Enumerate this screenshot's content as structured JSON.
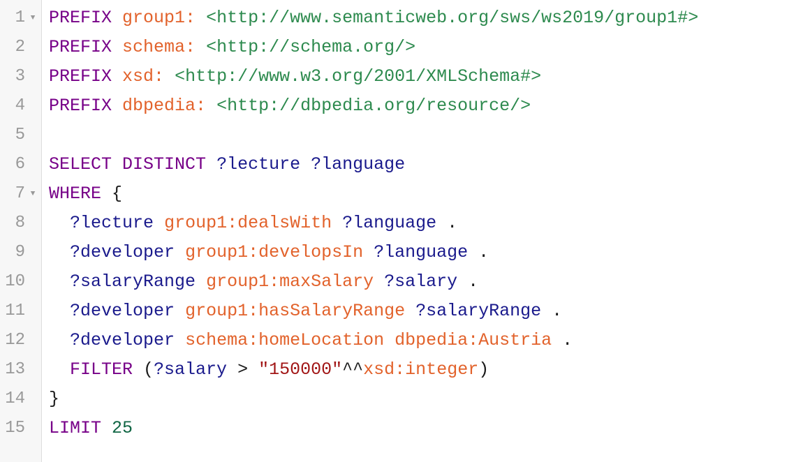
{
  "editor": {
    "fold_marker": "▼",
    "lines": [
      {
        "n": "1",
        "foldable": true,
        "tokens": [
          {
            "t": "PREFIX",
            "k": "kw"
          },
          {
            "t": " ",
            "k": "pn"
          },
          {
            "t": "group1:",
            "k": "pfx"
          },
          {
            "t": " ",
            "k": "pn"
          },
          {
            "t": "<http://www.semanticweb.org/sws/ws2019/group1#>",
            "k": "iri"
          }
        ]
      },
      {
        "n": "2",
        "foldable": false,
        "tokens": [
          {
            "t": "PREFIX",
            "k": "kw"
          },
          {
            "t": " ",
            "k": "pn"
          },
          {
            "t": "schema:",
            "k": "pfx"
          },
          {
            "t": " ",
            "k": "pn"
          },
          {
            "t": "<http://schema.org/>",
            "k": "iri"
          }
        ]
      },
      {
        "n": "3",
        "foldable": false,
        "tokens": [
          {
            "t": "PREFIX",
            "k": "kw"
          },
          {
            "t": " ",
            "k": "pn"
          },
          {
            "t": "xsd:",
            "k": "pfx"
          },
          {
            "t": " ",
            "k": "pn"
          },
          {
            "t": "<http://www.w3.org/2001/XMLSchema#>",
            "k": "iri"
          }
        ]
      },
      {
        "n": "4",
        "foldable": false,
        "tokens": [
          {
            "t": "PREFIX",
            "k": "kw"
          },
          {
            "t": " ",
            "k": "pn"
          },
          {
            "t": "dbpedia:",
            "k": "pfx"
          },
          {
            "t": " ",
            "k": "pn"
          },
          {
            "t": "<http://dbpedia.org/resource/>",
            "k": "iri"
          }
        ]
      },
      {
        "n": "5",
        "foldable": false,
        "tokens": []
      },
      {
        "n": "6",
        "foldable": false,
        "tokens": [
          {
            "t": "SELECT",
            "k": "kw"
          },
          {
            "t": " ",
            "k": "pn"
          },
          {
            "t": "DISTINCT",
            "k": "kw"
          },
          {
            "t": " ",
            "k": "pn"
          },
          {
            "t": "?lecture",
            "k": "var"
          },
          {
            "t": " ",
            "k": "pn"
          },
          {
            "t": "?language",
            "k": "var"
          }
        ]
      },
      {
        "n": "7",
        "foldable": true,
        "tokens": [
          {
            "t": "WHERE",
            "k": "kw"
          },
          {
            "t": " {",
            "k": "pn"
          }
        ]
      },
      {
        "n": "8",
        "foldable": false,
        "tokens": [
          {
            "t": "  ",
            "k": "pn"
          },
          {
            "t": "?lecture",
            "k": "var"
          },
          {
            "t": " ",
            "k": "pn"
          },
          {
            "t": "group1:dealsWith",
            "k": "pfx"
          },
          {
            "t": " ",
            "k": "pn"
          },
          {
            "t": "?language",
            "k": "var"
          },
          {
            "t": " .",
            "k": "pn"
          }
        ]
      },
      {
        "n": "9",
        "foldable": false,
        "tokens": [
          {
            "t": "  ",
            "k": "pn"
          },
          {
            "t": "?developer",
            "k": "var"
          },
          {
            "t": " ",
            "k": "pn"
          },
          {
            "t": "group1:developsIn",
            "k": "pfx"
          },
          {
            "t": " ",
            "k": "pn"
          },
          {
            "t": "?language",
            "k": "var"
          },
          {
            "t": " .",
            "k": "pn"
          }
        ]
      },
      {
        "n": "10",
        "foldable": false,
        "tokens": [
          {
            "t": "  ",
            "k": "pn"
          },
          {
            "t": "?salaryRange",
            "k": "var"
          },
          {
            "t": " ",
            "k": "pn"
          },
          {
            "t": "group1:maxSalary",
            "k": "pfx"
          },
          {
            "t": " ",
            "k": "pn"
          },
          {
            "t": "?salary",
            "k": "var"
          },
          {
            "t": " .",
            "k": "pn"
          }
        ]
      },
      {
        "n": "11",
        "foldable": false,
        "tokens": [
          {
            "t": "  ",
            "k": "pn"
          },
          {
            "t": "?developer",
            "k": "var"
          },
          {
            "t": " ",
            "k": "pn"
          },
          {
            "t": "group1:hasSalaryRange",
            "k": "pfx"
          },
          {
            "t": " ",
            "k": "pn"
          },
          {
            "t": "?salaryRange",
            "k": "var"
          },
          {
            "t": " .",
            "k": "pn"
          }
        ]
      },
      {
        "n": "12",
        "foldable": false,
        "tokens": [
          {
            "t": "  ",
            "k": "pn"
          },
          {
            "t": "?developer",
            "k": "var"
          },
          {
            "t": " ",
            "k": "pn"
          },
          {
            "t": "schema:homeLocation",
            "k": "pfx"
          },
          {
            "t": " ",
            "k": "pn"
          },
          {
            "t": "dbpedia:Austria",
            "k": "pfx"
          },
          {
            "t": " .",
            "k": "pn"
          }
        ]
      },
      {
        "n": "13",
        "foldable": false,
        "tokens": [
          {
            "t": "  ",
            "k": "pn"
          },
          {
            "t": "FILTER",
            "k": "kw"
          },
          {
            "t": " (",
            "k": "pn"
          },
          {
            "t": "?salary",
            "k": "var"
          },
          {
            "t": " ",
            "k": "pn"
          },
          {
            "t": ">",
            "k": "op"
          },
          {
            "t": " ",
            "k": "pn"
          },
          {
            "t": "\"150000\"",
            "k": "str"
          },
          {
            "t": "^^",
            "k": "op"
          },
          {
            "t": "xsd:integer",
            "k": "pfx"
          },
          {
            "t": ")",
            "k": "pn"
          }
        ]
      },
      {
        "n": "14",
        "foldable": false,
        "tokens": [
          {
            "t": "}",
            "k": "pn"
          }
        ]
      },
      {
        "n": "15",
        "foldable": false,
        "tokens": [
          {
            "t": "LIMIT",
            "k": "kw"
          },
          {
            "t": " ",
            "k": "pn"
          },
          {
            "t": "25",
            "k": "num"
          }
        ]
      }
    ]
  },
  "colors": {
    "keyword": "#770088",
    "prefixed_name": "#e2622b",
    "iri": "#2d8a4e",
    "variable": "#1a1a8c",
    "string": "#a11616",
    "number": "#116644",
    "gutter_bg": "#f7f7f7",
    "line_number": "#999999"
  }
}
